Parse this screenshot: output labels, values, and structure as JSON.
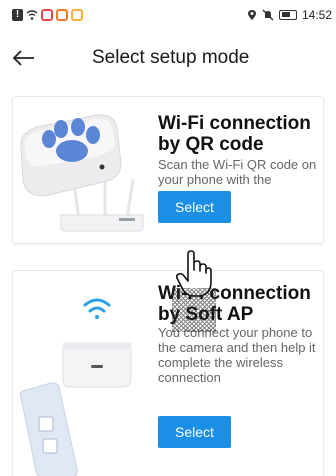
{
  "status_bar": {
    "time": "14:52",
    "icons": [
      "notification-icon",
      "wifi-icon",
      "app-icon-red",
      "app-icon-orange",
      "app-icon-yellow",
      "location-icon",
      "mute-icon",
      "battery-icon"
    ]
  },
  "header": {
    "back_icon": "arrow-left-icon",
    "title": "Select setup mode"
  },
  "modes": [
    {
      "title": "Wi-Fi connection by QR code",
      "description": "Scan the Wi-Fi QR code on your phone with the camera",
      "button_label": "Select",
      "illustration": "camera-and-router"
    },
    {
      "title": "Wi-Fi connection by Soft AP",
      "description": "You connect your phone to the camera and then help it complete the wireless connection",
      "button_label": "Select",
      "illustration": "phone-and-camera-wifi"
    }
  ],
  "colors": {
    "accent": "#1b8ee6",
    "paw": "#5b86d6"
  }
}
